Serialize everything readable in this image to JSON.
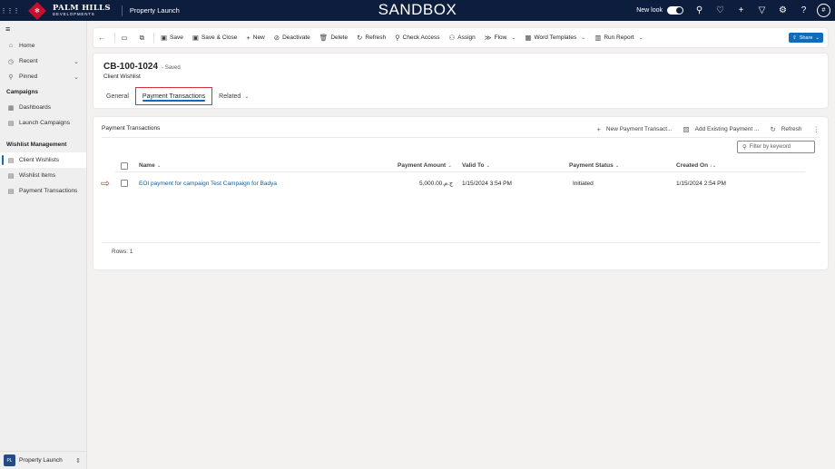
{
  "topbar": {
    "brand_line1": "PALM HILLS",
    "brand_line2": "DEVELOPMENTS",
    "app_name": "Property Launch",
    "environment": "SANDBOX",
    "new_look_label": "New look",
    "avatar_initial": "#"
  },
  "sidebar": {
    "items": [
      {
        "label": "Home"
      },
      {
        "label": "Recent"
      },
      {
        "label": "Pinned"
      }
    ],
    "sections": [
      {
        "title": "Campaigns",
        "items": [
          {
            "label": "Dashboards"
          },
          {
            "label": "Launch Campaigns"
          }
        ]
      },
      {
        "title": "Wishlist Management",
        "items": [
          {
            "label": "Client Wishlists"
          },
          {
            "label": "Wishlist Items"
          },
          {
            "label": "Payment Transactions"
          }
        ]
      }
    ],
    "area": {
      "badge": "PL",
      "label": "Property Launch"
    }
  },
  "commandbar": {
    "save": "Save",
    "save_close": "Save & Close",
    "new": "New",
    "deactivate": "Deactivate",
    "delete": "Delete",
    "refresh": "Refresh",
    "check_access": "Check Access",
    "assign": "Assign",
    "flow": "Flow",
    "word_templates": "Word Templates",
    "run_report": "Run Report",
    "share": "Share"
  },
  "record": {
    "title": "CB-100-1024",
    "saved_status": "- Saved",
    "entity": "Client Wishlist",
    "tabs": [
      "General",
      "Payment Transactions",
      "Related"
    ]
  },
  "subgrid": {
    "title": "Payment Transactions",
    "commands": {
      "new": "New Payment Transact...",
      "add_existing": "Add Existing Payment ...",
      "refresh": "Refresh"
    },
    "filter_placeholder": "Filter by keyword",
    "columns": [
      "Name",
      "Payment Amount",
      "Valid To",
      "Payment Status",
      "Created On"
    ],
    "rows": [
      {
        "name": "EOI payment for campaign Test Campaign for Badya",
        "amount": "5,000.00ج.م.‏",
        "valid_to": "1/15/2024 3:54 PM",
        "status": "Initiated",
        "created_on": "1/15/2024 2:54 PM"
      }
    ],
    "row_count": "Rows: 1"
  },
  "colors": {
    "topbar_bg": "#0d1d3d",
    "accent": "#0f6cbd",
    "highlight": "#d13438"
  }
}
